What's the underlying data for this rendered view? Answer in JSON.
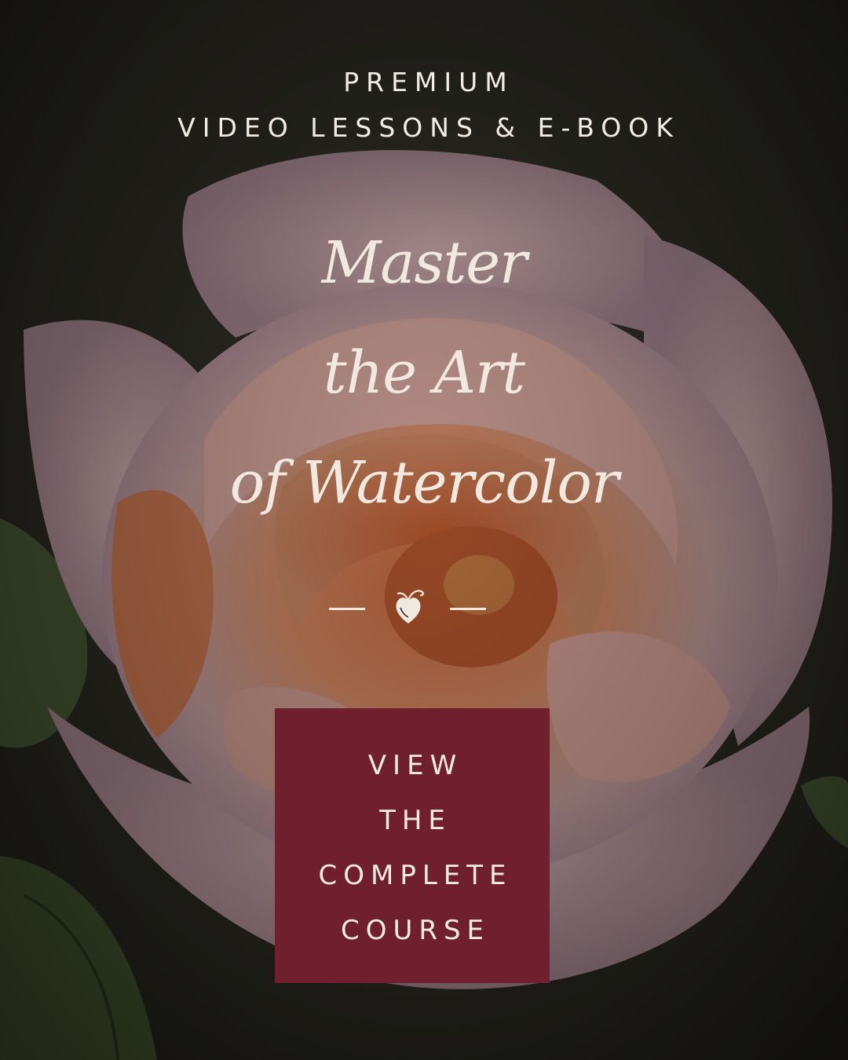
{
  "eyebrow": {
    "line1": "PREMIUM",
    "line2": "VIDEO LESSONS & E-BOOK"
  },
  "headline": {
    "line1": "Master",
    "line2": "the Art",
    "line3": "of Watercolor"
  },
  "divider": {
    "icon": "heart-ornament-icon"
  },
  "cta": {
    "line1": "VIEW",
    "line2": "THE",
    "line3": "COMPLETE",
    "line4": "COURSE",
    "background_color": "#6f1f2d"
  },
  "colors": {
    "text": "#f3ece4",
    "background": "#2b2a24"
  }
}
